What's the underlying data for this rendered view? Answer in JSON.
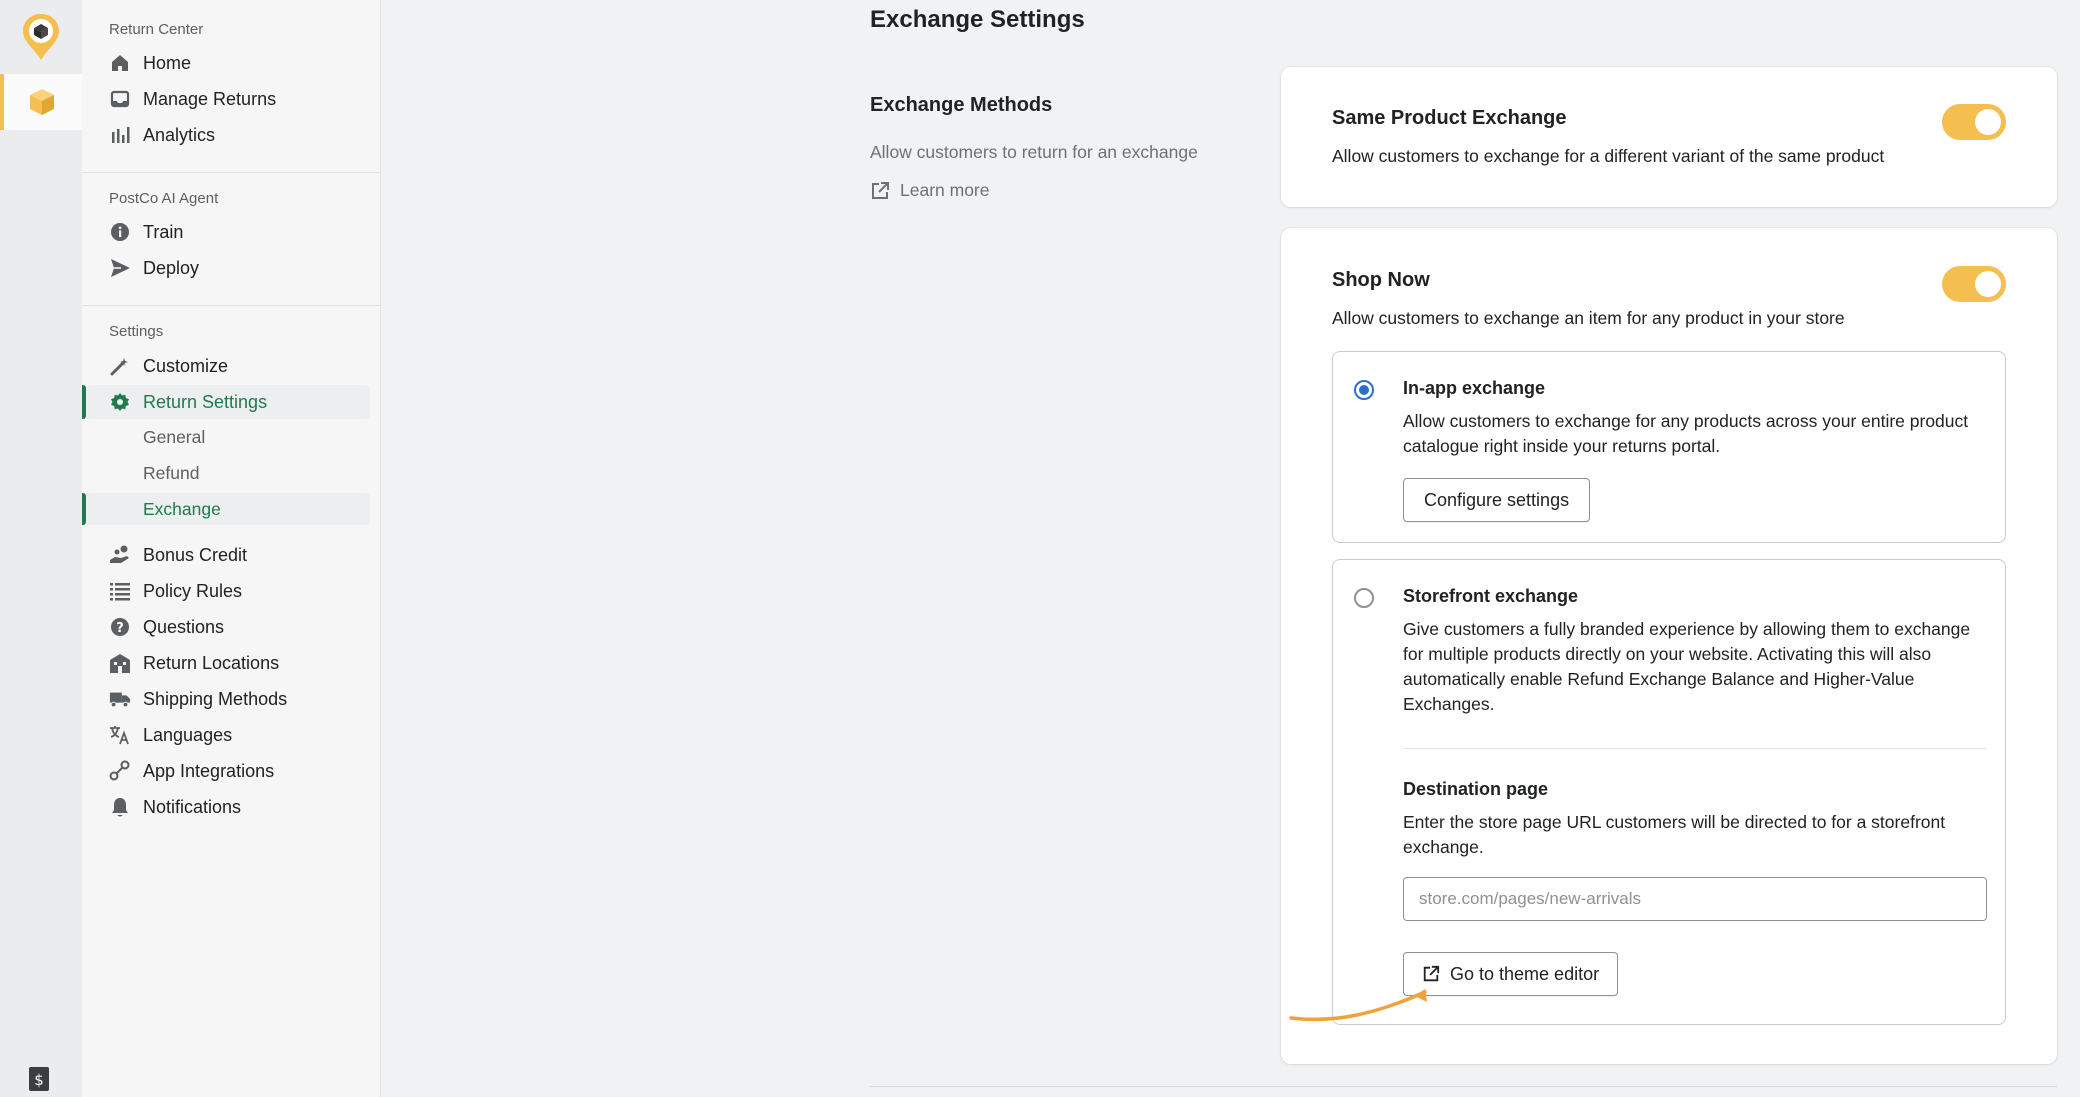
{
  "sidebar": {
    "sections": [
      {
        "title": "Return Center",
        "items": [
          {
            "label": "Home",
            "icon": "home-icon"
          },
          {
            "label": "Manage Returns",
            "icon": "inbox-icon"
          },
          {
            "label": "Analytics",
            "icon": "bar-chart-icon"
          }
        ]
      },
      {
        "title": "PostCo AI Agent",
        "items": [
          {
            "label": "Train",
            "icon": "info-icon"
          },
          {
            "label": "Deploy",
            "icon": "send-icon"
          }
        ]
      },
      {
        "title": "Settings",
        "items": [
          {
            "label": "Customize",
            "icon": "magic-wand-icon"
          },
          {
            "label": "Return Settings",
            "icon": "gear-icon",
            "active": true
          },
          {
            "label": "Bonus Credit",
            "icon": "coins-icon"
          },
          {
            "label": "Policy Rules",
            "icon": "list-icon"
          },
          {
            "label": "Questions",
            "icon": "question-icon"
          },
          {
            "label": "Return Locations",
            "icon": "building-icon"
          },
          {
            "label": "Shipping Methods",
            "icon": "truck-icon"
          },
          {
            "label": "Languages",
            "icon": "translate-icon"
          },
          {
            "label": "App Integrations",
            "icon": "integration-icon"
          },
          {
            "label": "Notifications",
            "icon": "bell-icon"
          }
        ],
        "sub_items": [
          {
            "label": "General"
          },
          {
            "label": "Refund"
          },
          {
            "label": "Exchange",
            "active": true
          }
        ]
      }
    ]
  },
  "main": {
    "title": "Exchange Settings",
    "section": {
      "heading": "Exchange Methods",
      "description": "Allow customers to return for an exchange",
      "learn_more": "Learn more"
    },
    "same_product": {
      "title": "Same Product Exchange",
      "description": "Allow customers to exchange for a different variant of the same product",
      "enabled": true
    },
    "shop_now": {
      "title": "Shop Now",
      "description": "Allow customers to exchange an item for any product in your store",
      "enabled": true,
      "in_app": {
        "title": "In-app exchange",
        "description": "Allow customers to exchange for any products across your entire product catalogue right inside your returns portal.",
        "button": "Configure settings",
        "selected": true
      },
      "storefront": {
        "title": "Storefront exchange",
        "description": "Give customers a fully branded experience by allowing them to exchange for multiple products directly on your website. Activating this will also automatically enable Refund Exchange Balance and Higher-Value Exchanges.",
        "selected": false,
        "destination": {
          "title": "Destination page",
          "description": "Enter the store page URL customers will be directed to for a storefront exchange.",
          "placeholder": "store.com/pages/new-arrivals",
          "value": ""
        },
        "theme_button": "Go to theme editor"
      }
    }
  },
  "colors": {
    "accent_green": "#207a4e",
    "toggle_on": "#f4bf4f",
    "radio_blue": "#2c6ecb",
    "annotation_arrow": "#f0a23a"
  }
}
